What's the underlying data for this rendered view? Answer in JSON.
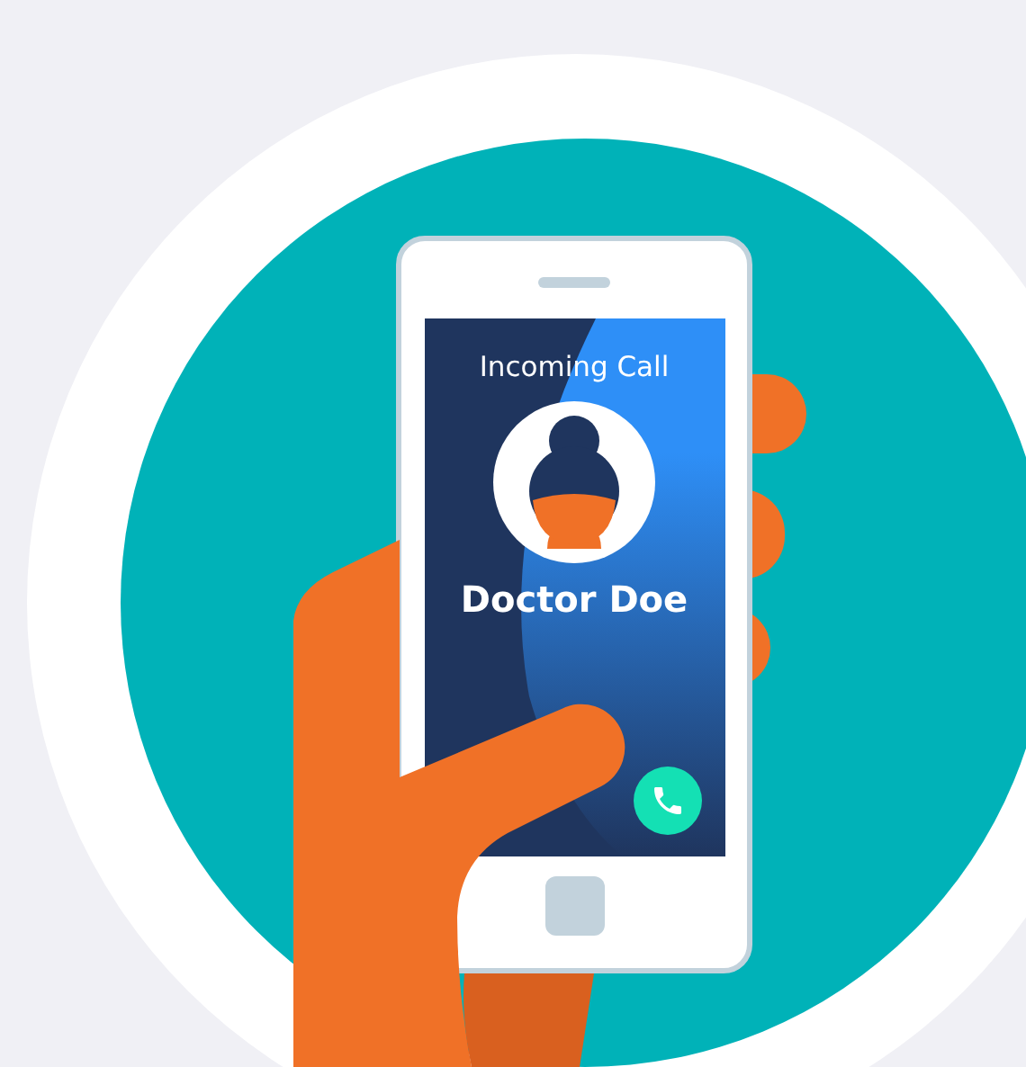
{
  "screen": {
    "title": "Incoming Call",
    "caller": "Doctor Doe"
  }
}
